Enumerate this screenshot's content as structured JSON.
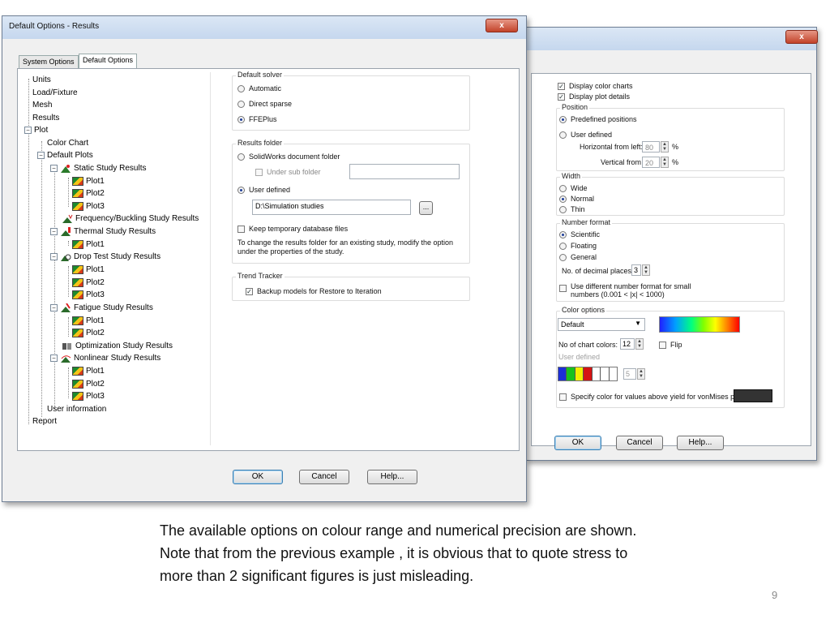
{
  "left_window": {
    "title": "Default Options - Results",
    "close_glyph": "x",
    "tabs": [
      "System Options",
      "Default Options"
    ],
    "tree": {
      "units": "Units",
      "load": "Load/Fixture",
      "mesh": "Mesh",
      "results": "Results",
      "plot": "Plot",
      "color_chart": "Color Chart",
      "default_plots": "Default Plots",
      "static": "Static Study Results",
      "freq": "Frequency/Buckling Study Results",
      "thermal": "Thermal Study Results",
      "drop": "Drop Test Study Results",
      "fatigue": "Fatigue Study Results",
      "optim": "Optimization Study Results",
      "nonlinear": "Nonlinear Study Results",
      "user_info": "User information",
      "report": "Report",
      "plot1": "Plot1",
      "plot2": "Plot2",
      "plot3": "Plot3"
    },
    "solver": {
      "label": "Default solver",
      "automatic": "Automatic",
      "direct": "Direct sparse",
      "ffeplus": "FFEPlus"
    },
    "results_folder": {
      "label": "Results folder",
      "sw_folder": "SolidWorks document folder",
      "under_sub": "Under sub folder",
      "user_defined": "User defined",
      "path": "D:\\Simulation studies",
      "browse": "...",
      "keep_temp": "Keep temporary database files",
      "note": "To change the results folder for an existing study, modify the option under the properties of the study."
    },
    "trend": {
      "label": "Trend Tracker",
      "backup": "Backup models for Restore to Iteration"
    },
    "buttons": {
      "ok": "OK",
      "cancel": "Cancel",
      "help": "Help..."
    }
  },
  "right_window": {
    "close_glyph": "x",
    "display_color_charts": "Display color charts",
    "display_plot_details": "Display plot details",
    "position": {
      "label": "Position",
      "predefined": "Predefined positions",
      "user_defined": "User defined",
      "h_label": "Horizontal from left:",
      "h_value": "80",
      "v_label": "Vertical from top:",
      "v_value": "20",
      "unit": "%"
    },
    "width": {
      "label": "Width",
      "wide": "Wide",
      "normal": "Normal",
      "thin": "Thin"
    },
    "number_format": {
      "label": "Number format",
      "scientific": "Scientific",
      "floating": "Floating",
      "general": "General",
      "decimal_label": "No. of decimal places:",
      "decimal_value": "3",
      "diff_format": "Use different number format for small",
      "diff_format2": "numbers (0.001 < |x| < 1000)"
    },
    "color_options": {
      "label": "Color options",
      "selected": "Default",
      "chart_colors_label": "No of chart colors:",
      "chart_colors_value": "12",
      "flip": "Flip",
      "user_defined": "User defined",
      "user_count": "5",
      "yield_label": "Specify color for values above yield for vonMises plot"
    },
    "buttons": {
      "ok": "OK",
      "cancel": "Cancel",
      "help": "Help..."
    }
  },
  "caption": {
    "line1": "The available options on colour range and numerical precision are shown.",
    "line2": "Note that from the previous example , it is obvious that to quote stress to",
    "line3": "more than 2 significant figures is just misleading."
  },
  "page_number": "9",
  "colors": {
    "title_gradient": "#c5d7ee",
    "close_red": "#c3432a",
    "yield_swatch": "#333333"
  }
}
